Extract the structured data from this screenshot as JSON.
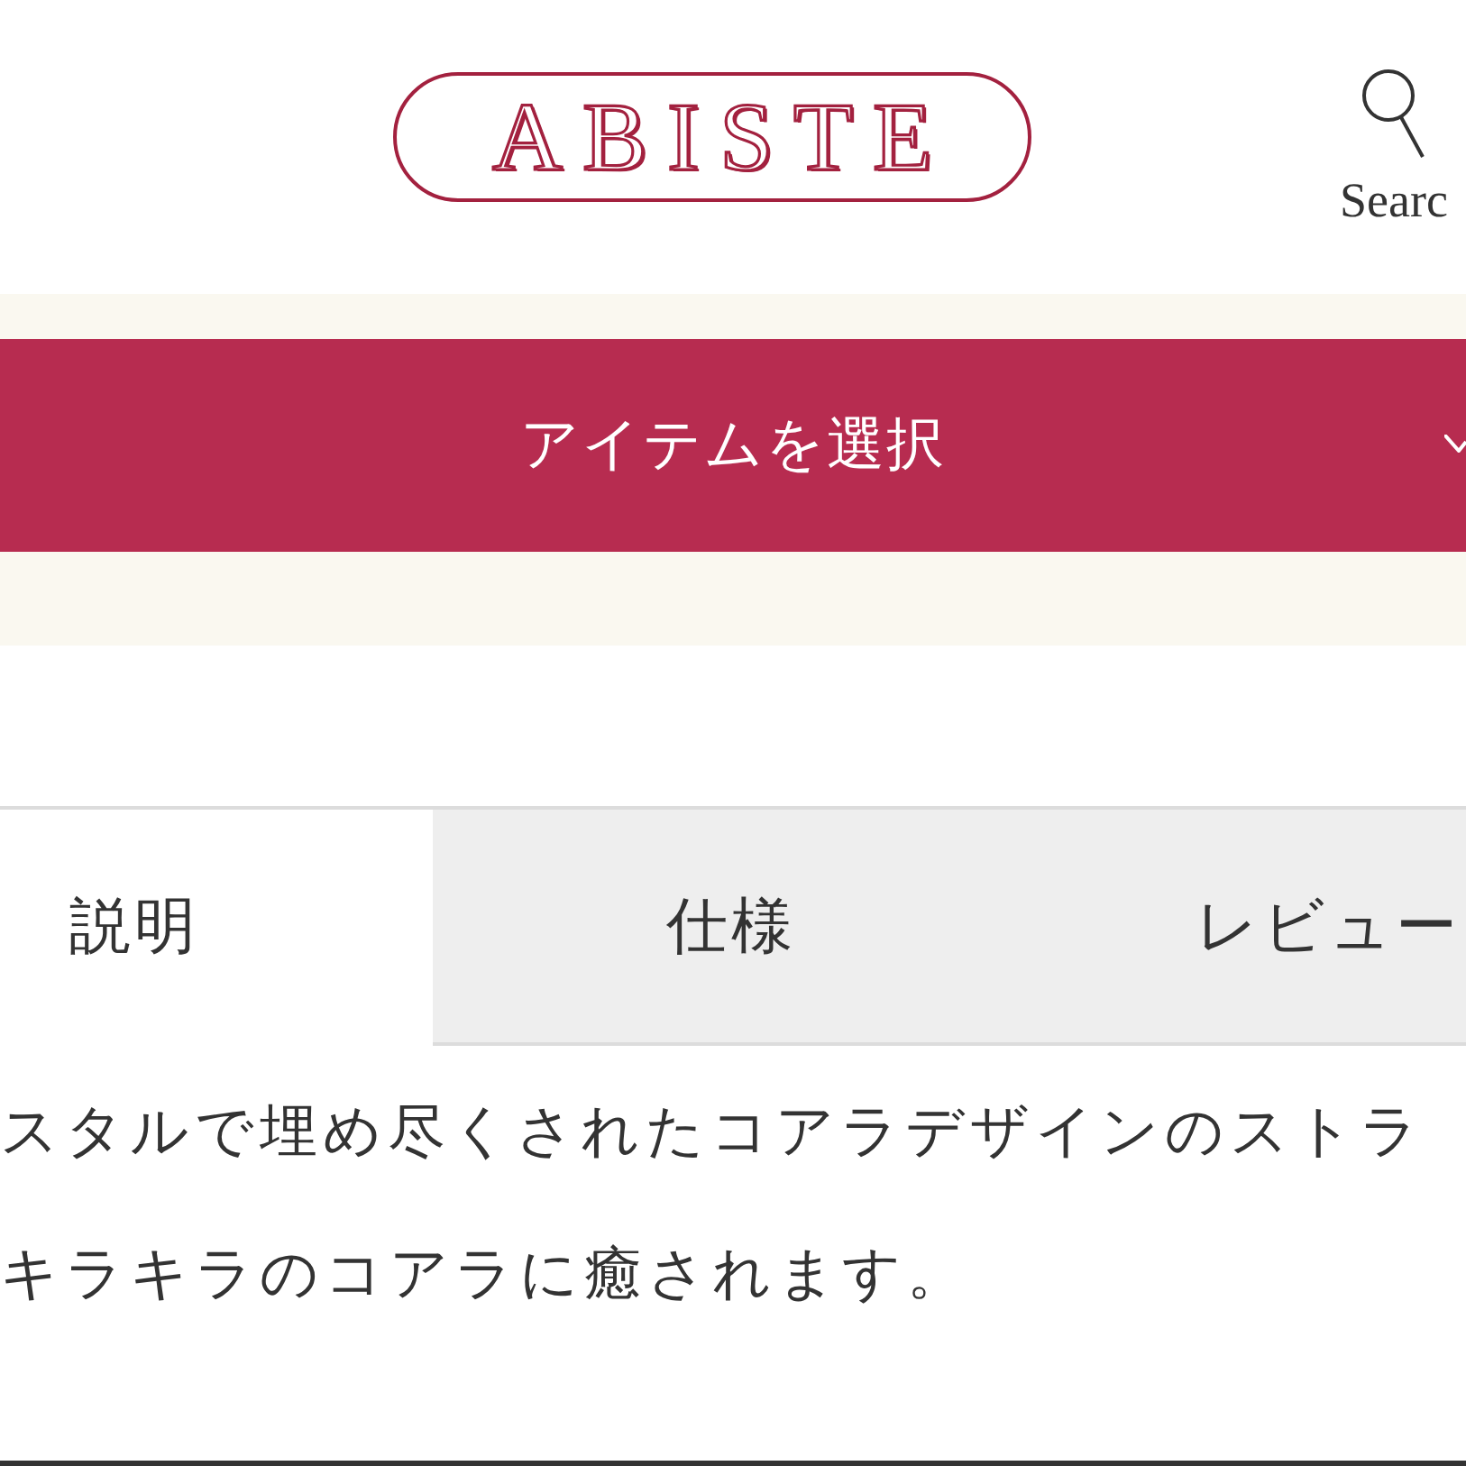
{
  "header": {
    "logo": "ABISTE",
    "search": {
      "label": "Searc"
    }
  },
  "item_select": {
    "label": "アイテムを選択"
  },
  "tabs": [
    {
      "label": "説明",
      "selected": true
    },
    {
      "label": "仕様",
      "selected": false
    },
    {
      "label": "レビュー",
      "selected": false
    }
  ],
  "description": {
    "lines": [
      "スタルで埋め尽くされたコアラデザインのストラ",
      "キラキラのコアラに癒されます。"
    ]
  }
}
